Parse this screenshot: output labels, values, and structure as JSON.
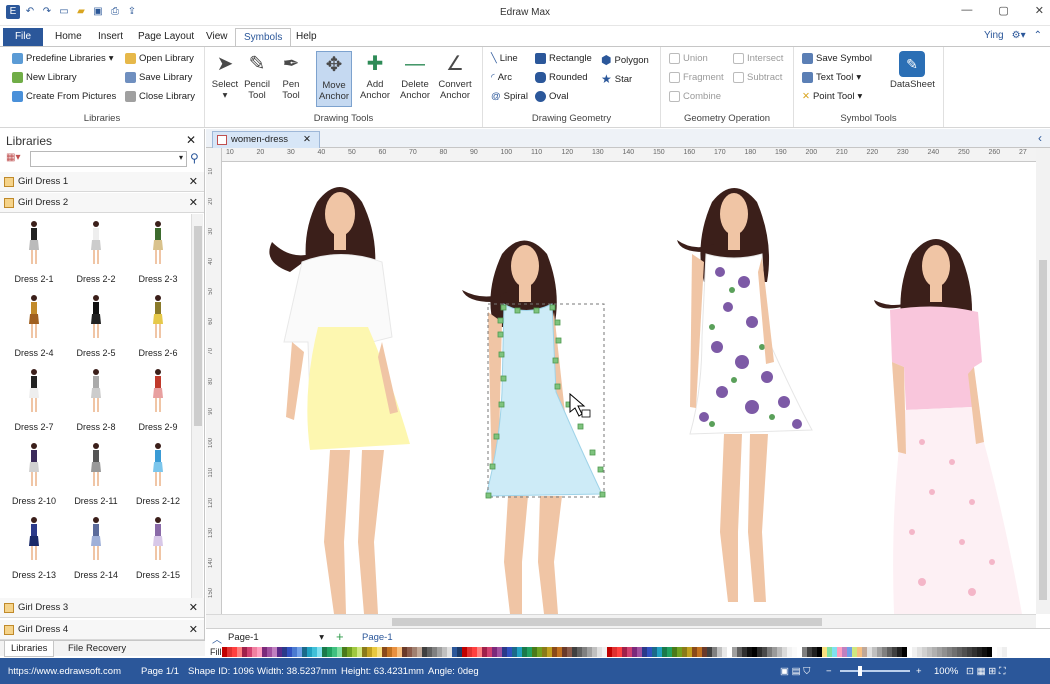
{
  "app": {
    "title": "Edraw Max",
    "user": "Ying"
  },
  "menu_tabs": [
    "File",
    "Home",
    "Insert",
    "Page Layout",
    "View",
    "Symbols",
    "Help"
  ],
  "active_tab": "Symbols",
  "ribbon": {
    "libraries": {
      "label": "Libraries",
      "items": [
        "Predefine Libraries",
        "New Library",
        "Create From Pictures",
        "Open Library",
        "Save Library",
        "Close Library"
      ]
    },
    "drawing_tools": {
      "label": "Drawing Tools",
      "buttons": [
        {
          "label": "Select",
          "icon": "arrow-pointer-icon"
        },
        {
          "label": "Pencil Tool",
          "icon": "pencil-icon"
        },
        {
          "label": "Pen Tool",
          "icon": "pen-icon"
        },
        {
          "label": "Move Anchor",
          "icon": "move-anchor-icon"
        },
        {
          "label": "Add Anchor",
          "icon": "add-anchor-icon"
        },
        {
          "label": "Delete Anchor",
          "icon": "delete-anchor-icon"
        },
        {
          "label": "Convert Anchor",
          "icon": "convert-anchor-icon"
        }
      ]
    },
    "drawing_geometry": {
      "label": "Drawing Geometry",
      "items": [
        "Line",
        "Arc",
        "Spiral",
        "Rectangle",
        "Rounded",
        "Oval",
        "Polygon",
        "Star"
      ]
    },
    "geometry_operation": {
      "label": "Geometry Operation",
      "items": [
        "Union",
        "Fragment",
        "Combine",
        "Intersect",
        "Subtract"
      ]
    },
    "symbol_tools": {
      "label": "Symbol Tools",
      "items": [
        "Save Symbol",
        "Text Tool",
        "Point Tool",
        "DataSheet"
      ]
    }
  },
  "libraries_panel": {
    "title": "Libraries",
    "libraries": [
      "Girl Dress 1",
      "Girl Dress 2",
      "Girl Dress 3",
      "Girl Dress 4"
    ],
    "shapes": [
      "Dress 2-1",
      "Dress 2-2",
      "Dress 2-3",
      "Dress 2-4",
      "Dress 2-5",
      "Dress 2-6",
      "Dress 2-7",
      "Dress 2-8",
      "Dress 2-9",
      "Dress 2-10",
      "Dress 2-11",
      "Dress 2-12",
      "Dress 2-13",
      "Dress 2-14",
      "Dress 2-15"
    ],
    "bottom_tabs": [
      "Libraries",
      "File Recovery"
    ]
  },
  "document": {
    "tab": "women-dress",
    "ruler_marks": [
      "10",
      "20",
      "30",
      "40",
      "50",
      "60",
      "70",
      "80",
      "90",
      "100",
      "110",
      "120",
      "130",
      "140",
      "150",
      "160",
      "170",
      "180",
      "190",
      "200",
      "210",
      "220",
      "230",
      "240",
      "250",
      "260",
      "27"
    ],
    "vruler_marks": [
      "10",
      "20",
      "30",
      "40",
      "50",
      "60",
      "70",
      "80",
      "90",
      "100",
      "110",
      "120",
      "130",
      "140",
      "150"
    ]
  },
  "pages": {
    "current": "Page-1",
    "tab": "Page-1"
  },
  "fill_label": "Fill",
  "status": {
    "url": "https://www.edrawsoft.com",
    "page": "Page 1/1",
    "shape_id": "Shape ID: 1096",
    "width": "Width: 38.5237mm",
    "height": "Height: 63.4231mm",
    "angle": "Angle: 0deg",
    "zoom": "100%"
  }
}
